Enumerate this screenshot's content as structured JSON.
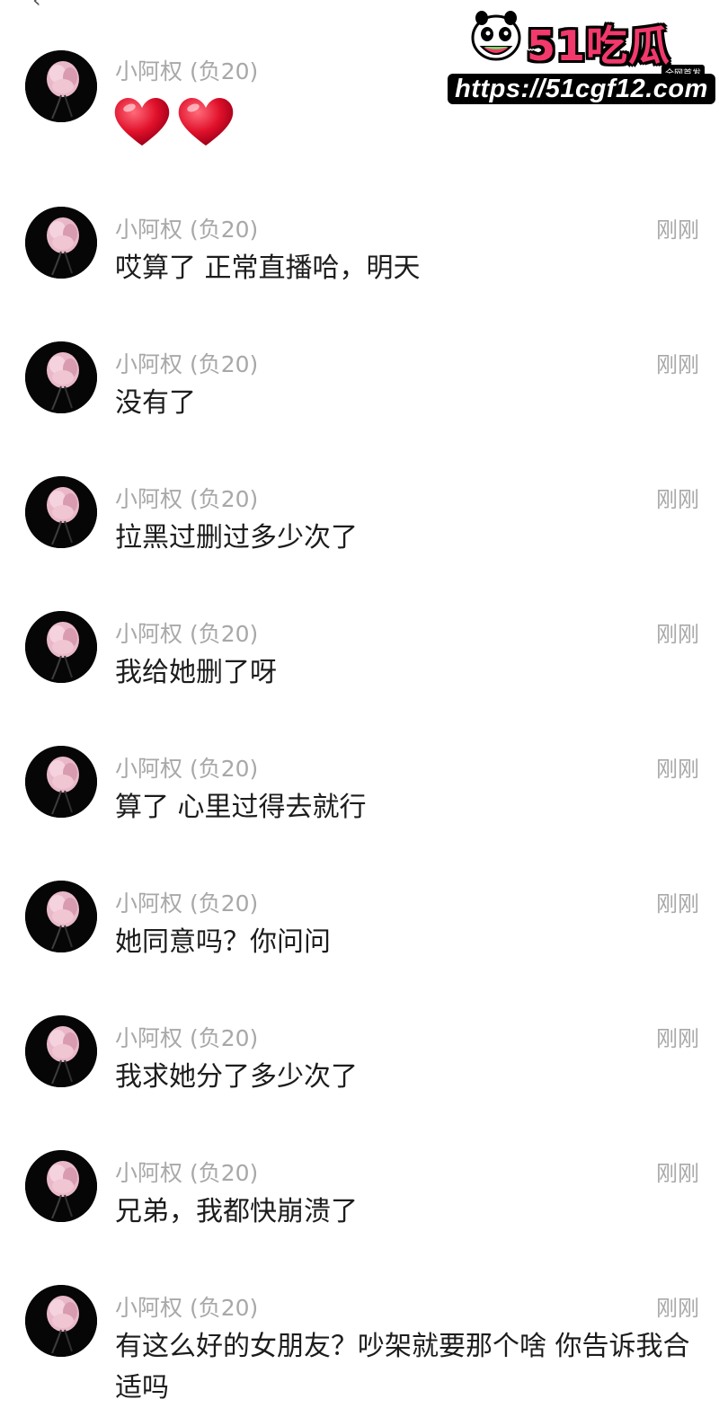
{
  "watermark": {
    "brand": "51吃瓜",
    "badge": "全网首发",
    "url": "https://51cgf12.com"
  },
  "messages": [
    {
      "name": "小阿权 (负20)",
      "time": "",
      "text": "",
      "emoji": [
        "heart",
        "heart"
      ]
    },
    {
      "name": "小阿权 (负20)",
      "time": "刚刚",
      "text": "哎算了 正常直播哈，明天"
    },
    {
      "name": "小阿权 (负20)",
      "time": "刚刚",
      "text": "没有了"
    },
    {
      "name": "小阿权 (负20)",
      "time": "刚刚",
      "text": "拉黑过删过多少次了"
    },
    {
      "name": "小阿权 (负20)",
      "time": "刚刚",
      "text": "我给她删了呀"
    },
    {
      "name": "小阿权 (负20)",
      "time": "刚刚",
      "text": "算了 心里过得去就行"
    },
    {
      "name": "小阿权 (负20)",
      "time": "刚刚",
      "text": "她同意吗？你问问"
    },
    {
      "name": "小阿权 (负20)",
      "time": "刚刚",
      "text": "我求她分了多少次了"
    },
    {
      "name": "小阿权 (负20)",
      "time": "刚刚",
      "text": "兄弟，我都快崩溃了"
    },
    {
      "name": "小阿权 (负20)",
      "time": "刚刚",
      "text": "有这么好的女朋友？吵架就要那个啥 你告诉我合适吗"
    }
  ],
  "colors": {
    "name": "#a8a8a8",
    "text": "#1c1c1c",
    "heart": "#e0102a",
    "brand": "#f2396b"
  }
}
